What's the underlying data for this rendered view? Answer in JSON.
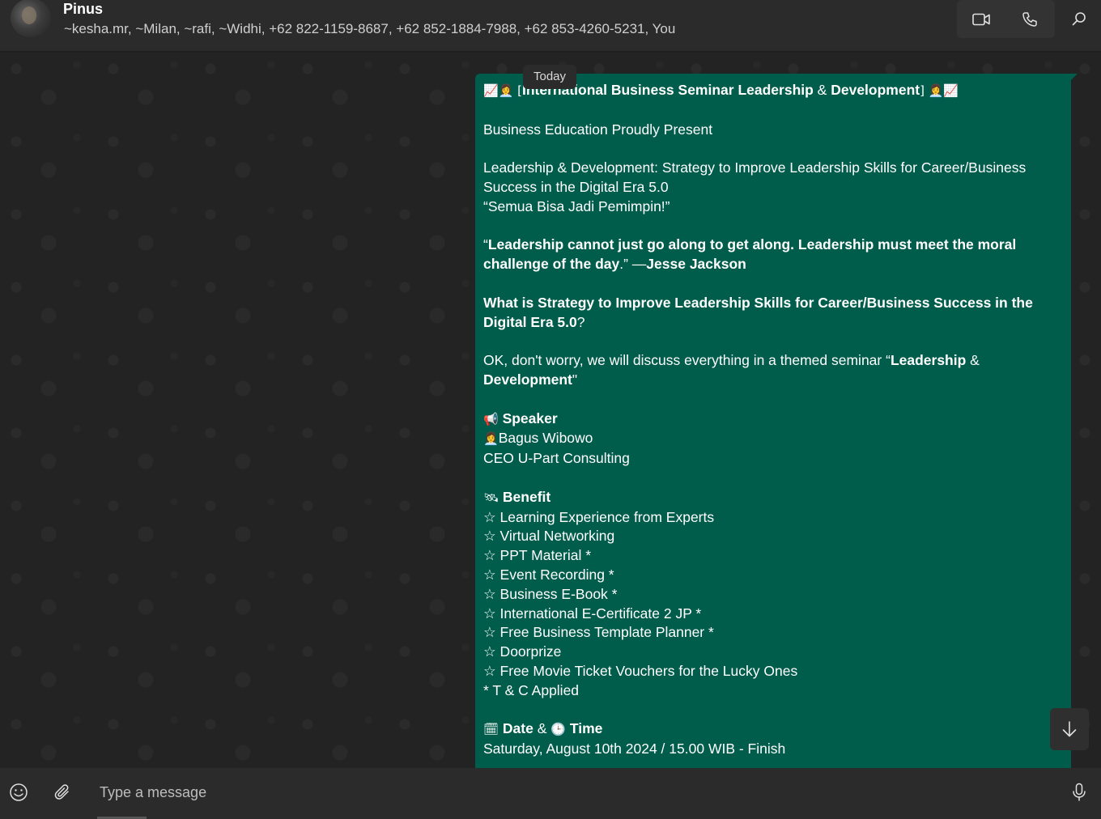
{
  "header": {
    "name": "Pinus",
    "members": "~kesha.mr, ~Milan, ~rafi, ~Widhi, +62 822-1159-8687, +62 852-1884-7988, +62 853-4260-5231, You",
    "icons": [
      "video-call-icon",
      "voice-call-icon",
      "search-icon"
    ]
  },
  "chat": {
    "date_chip": "Today",
    "message": {
      "title_prefix": "📈👩‍💼 [",
      "title_bold": "International Business Seminar Leadership",
      "title_amp": " & ",
      "title_bold2": "Development",
      "title_suffix": "] 👩‍💼📈",
      "line_present": "Business Education Proudly Present",
      "line_topic": "Leadership & Development: Strategy to Improve Leadership Skills for Career/Business Success in the Digital Era 5.0",
      "line_tagline": "“Semua Bisa Jadi Pemimpin!”",
      "quote_open": "“",
      "quote_bold": "Leadership cannot just go along to get along. Leadership must meet the moral challenge of the day",
      "quote_mid": ".” —",
      "quote_author": "Jesse Jackson",
      "question_bold": "What is Strategy to Improve Leadership Skills for Career/Business Success in the Digital Era 5.0",
      "question_mark": "?",
      "discuss_text": "OK, don't worry, we will discuss everything in a themed seminar “",
      "discuss_bold1": "Leadership",
      "discuss_amp": " & ",
      "discuss_bold2": "Development",
      "discuss_end": "\"",
      "speaker_icon": "📢",
      "speaker_label": "Speaker",
      "speaker_name_icon": "👩‍💼",
      "speaker_name": "Bagus Wibowo",
      "speaker_role": "CEO U-Part Consulting",
      "benefit_icon": "🛰",
      "benefit_label": "Benefit",
      "benefits": [
        "☆ Learning Experience from Experts",
        "☆ Virtual Networking",
        "☆ PPT Material *",
        "☆ Event Recording *",
        "☆ Business E-Book *",
        "☆ International E-Certificate 2 JP *",
        "☆ Free Business Template Planner *",
        "☆ Doorprize",
        "☆ Free Movie Ticket Vouchers for the Lucky Ones"
      ],
      "tnc": "* T & C Applied",
      "date_icon": "🗓",
      "date_label": "Date",
      "date_amp": " & ",
      "time_icon": "🕒",
      "time_label": "Time",
      "date_value": "Saturday, August 10th  2024 / 15.00 WIB - Finish"
    }
  },
  "composer": {
    "placeholder": "Type a message",
    "icons": [
      "emoji-icon",
      "attach-icon",
      "microphone-icon"
    ]
  }
}
